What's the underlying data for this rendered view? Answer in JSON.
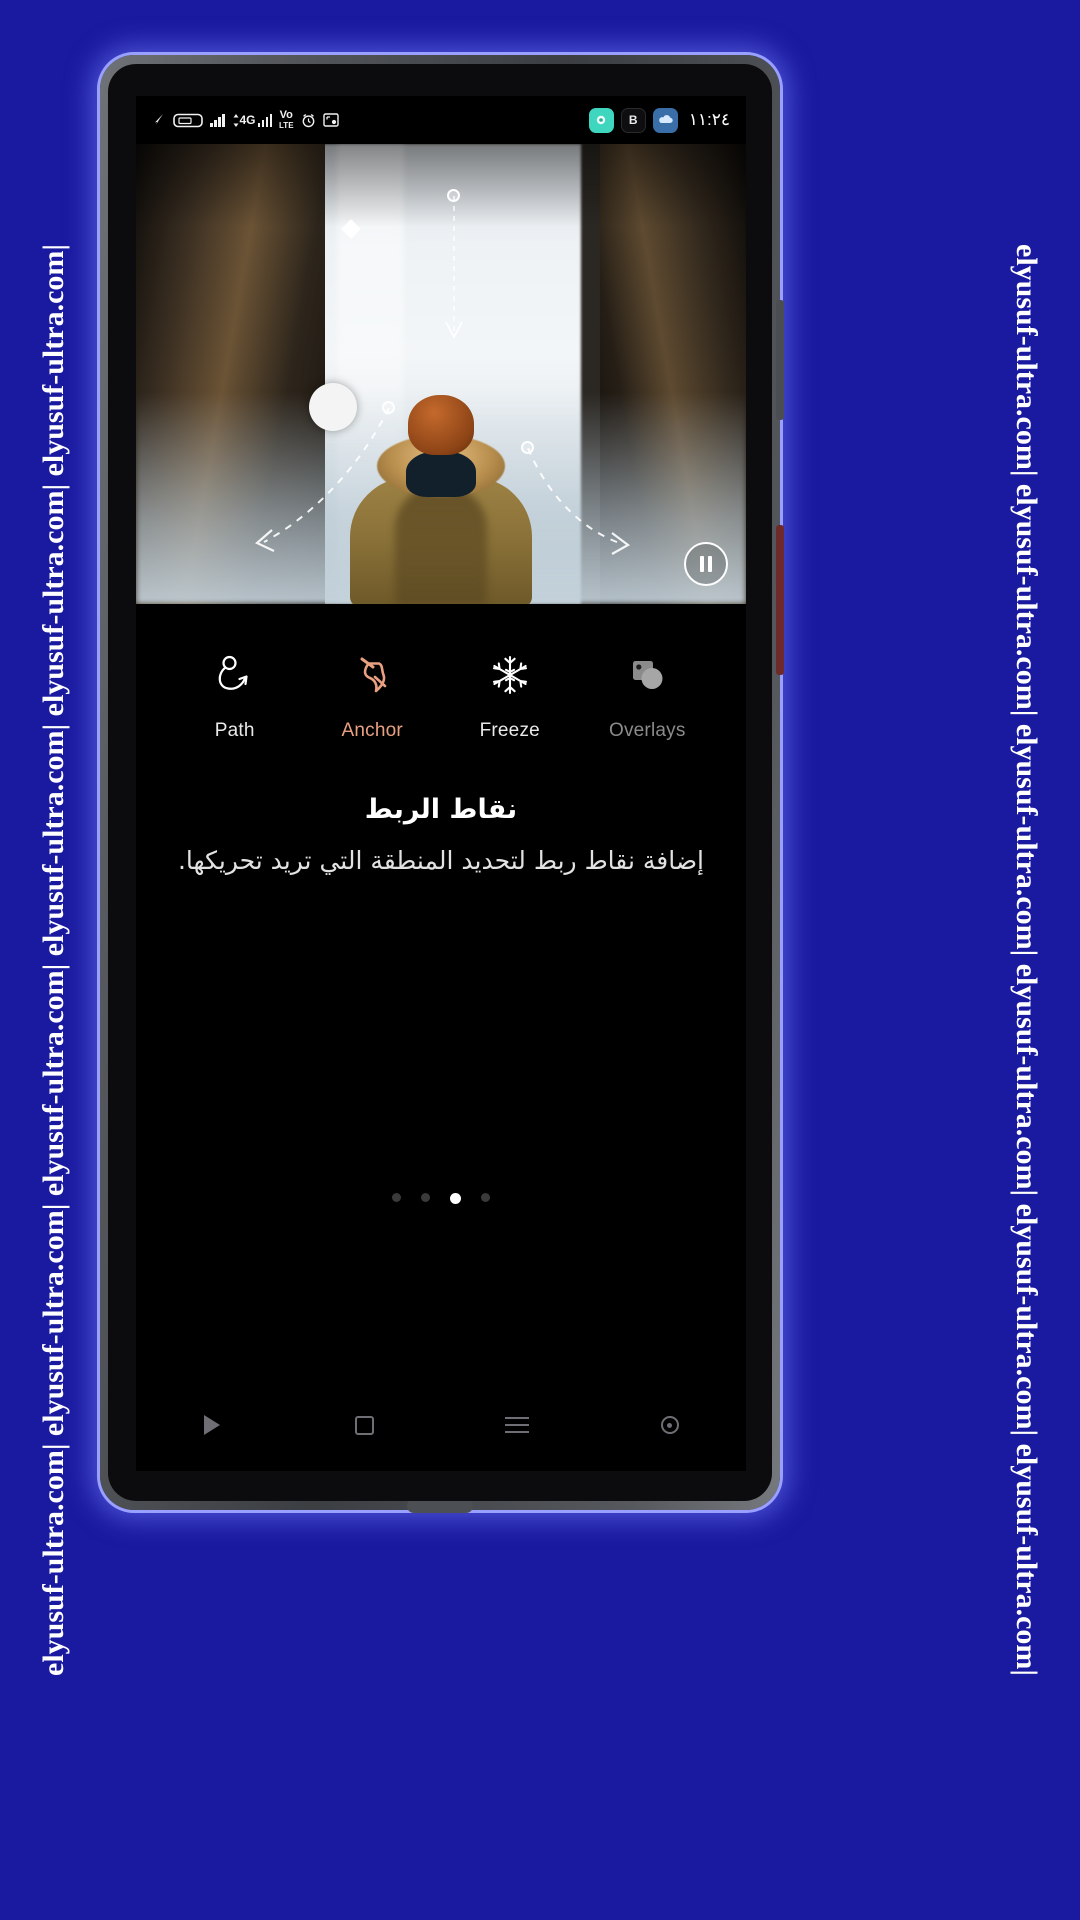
{
  "watermark": {
    "text": "elyusuf-ultra.com| elyusuf-ultra.com| elyusuf-ultra.com| elyusuf-ultra.com| elyusuf-ultra.com| elyusuf-ultra.com|",
    "background_color": "#1a1aa0",
    "text_color": "#ffffff"
  },
  "status_bar": {
    "time": "١١:٢٤",
    "left_icons": [
      {
        "name": "location-arrow-icon",
        "glyph": "➤"
      },
      {
        "name": "tv-cast-icon",
        "label": "TV"
      },
      {
        "name": "signal-bars-icon",
        "label": ""
      },
      {
        "name": "mobile-data-4g-icon",
        "label": "4G"
      },
      {
        "name": "volte-icon",
        "label": "Vo"
      },
      {
        "name": "volte-icon-sub",
        "label": "LTE"
      },
      {
        "name": "alarm-clock-icon",
        "glyph": "⏰"
      },
      {
        "name": "screenshot-icon",
        "glyph": "⧉"
      }
    ],
    "right_badges": [
      {
        "name": "app-badge-teal",
        "label": "◉",
        "color": "#3fd6c0"
      },
      {
        "name": "app-badge-b",
        "label": "B",
        "color": "#0e0e10"
      },
      {
        "name": "app-badge-blue",
        "label": "☁",
        "color": "#3a6ea8"
      }
    ]
  },
  "preview": {
    "name": "video-preview-waterfall",
    "pause_button_label": "Pause",
    "handles": [
      {
        "name": "path-node-top",
        "type": "dot"
      },
      {
        "name": "path-node-left",
        "type": "dot"
      },
      {
        "name": "path-node-right",
        "type": "dot"
      },
      {
        "name": "anchor-point-diamond",
        "type": "diamond"
      },
      {
        "name": "speed-handle-large",
        "type": "big-dot"
      }
    ]
  },
  "toolbar": {
    "items": [
      {
        "id": "path",
        "label": "Path",
        "icon": "path-curve-icon",
        "state": "normal",
        "color": "#e9e9e9"
      },
      {
        "id": "anchor",
        "label": "Anchor",
        "icon": "pushpin-icon",
        "state": "active",
        "color": "#e8a081"
      },
      {
        "id": "freeze",
        "label": "Freeze",
        "icon": "snowflake-icon",
        "state": "normal",
        "color": "#e9e9e9"
      },
      {
        "id": "overlays",
        "label": "Overlays",
        "icon": "overlay-shapes-icon",
        "state": "dim",
        "color": "#8b8b8b"
      }
    ]
  },
  "help": {
    "title": "نقاط الربط",
    "body": "إضافة نقاط ربط لتحديد المنطقة التي تريد تحريكها."
  },
  "pager": {
    "total": 4,
    "active_index": 3
  },
  "nav_bar": {
    "items": [
      {
        "name": "nav-play-button",
        "label": "Play"
      },
      {
        "name": "nav-home-button",
        "label": "Home"
      },
      {
        "name": "nav-recents-button",
        "label": "Recents"
      },
      {
        "name": "nav-assistant-button",
        "label": "Assistant"
      }
    ]
  }
}
